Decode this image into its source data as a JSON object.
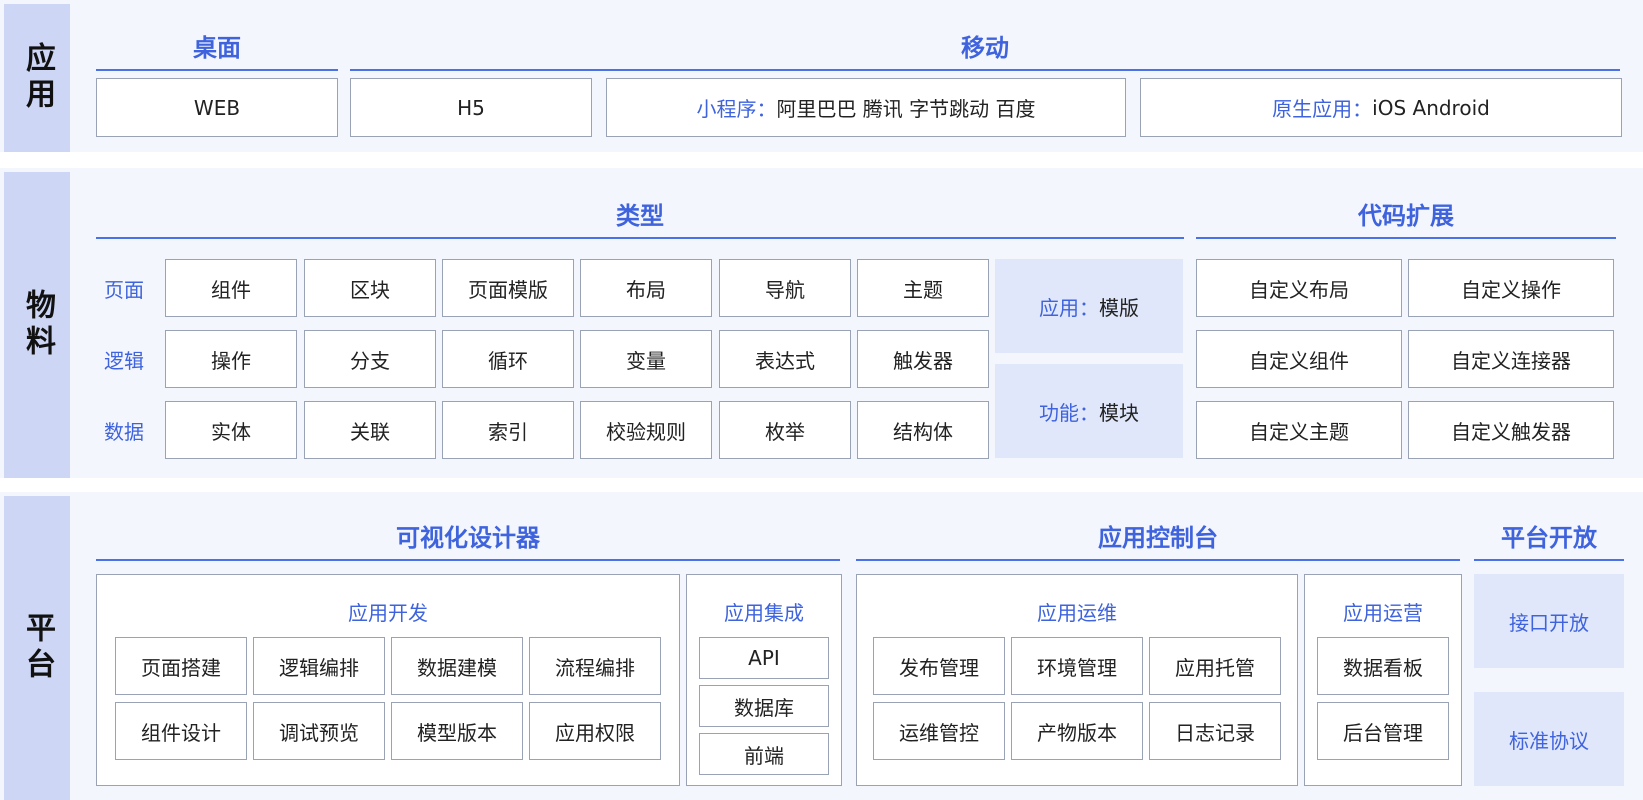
{
  "app_layer": {
    "tab": "应用",
    "desktop_title": "桌面",
    "mobile_title": "移动",
    "web": "WEB",
    "h5": "H5",
    "miniprogram_label": "小程序：",
    "miniprogram_value": "阿里巴巴 腾讯 字节跳动 百度",
    "native_label": "原生应用：",
    "native_value": "iOS Android"
  },
  "material_layer": {
    "tab": "物料",
    "types_title": "类型",
    "code_ext_title": "代码扩展",
    "rows": [
      {
        "label": "页面",
        "items": [
          "组件",
          "区块",
          "页面模版",
          "布局",
          "导航",
          "主题"
        ]
      },
      {
        "label": "逻辑",
        "items": [
          "操作",
          "分支",
          "循环",
          "变量",
          "表达式",
          "触发器"
        ]
      },
      {
        "label": "数据",
        "items": [
          "实体",
          "关联",
          "索引",
          "校验规则",
          "枚举",
          "结构体"
        ]
      }
    ],
    "app_template_label": "应用：",
    "app_template_value": "模版",
    "func_module_label": "功能：",
    "func_module_value": "模块",
    "code_ext_items": [
      "自定义布局",
      "自定义操作",
      "自定义组件",
      "自定义连接器",
      "自定义主题",
      "自定义触发器"
    ]
  },
  "platform_layer": {
    "tab": "平台",
    "designer_title": "可视化设计器",
    "console_title": "应用控制台",
    "open_title": "平台开放",
    "app_dev": {
      "title": "应用开发",
      "items": [
        "页面搭建",
        "逻辑编排",
        "数据建模",
        "流程编排",
        "组件设计",
        "调试预览",
        "模型版本",
        "应用权限"
      ]
    },
    "app_integration": {
      "title": "应用集成",
      "items": [
        "API",
        "数据库",
        "前端"
      ]
    },
    "app_ops": {
      "title": "应用运维",
      "items": [
        "发布管理",
        "环境管理",
        "应用托管",
        "运维管控",
        "产物版本",
        "日志记录"
      ]
    },
    "app_operation": {
      "title": "应用运营",
      "items": [
        "数据看板",
        "后台管理"
      ]
    },
    "open_items": [
      "接口开放",
      "标准协议"
    ]
  }
}
